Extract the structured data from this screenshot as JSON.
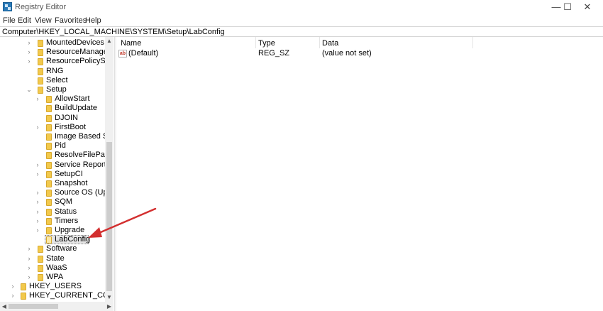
{
  "window": {
    "title": "Registry Editor",
    "controls": {
      "minimize": "—",
      "maximize": "☐",
      "close": "✕"
    }
  },
  "menu": [
    "File",
    "Edit",
    "View",
    "Favorites",
    "Help"
  ],
  "address": "Computer\\HKEY_LOCAL_MACHINE\\SYSTEM\\Setup\\LabConfig",
  "tree": [
    {
      "label": "MountedDevices",
      "depth": 3,
      "expander": "collapsed"
    },
    {
      "label": "ResourceManager",
      "depth": 3,
      "expander": "collapsed"
    },
    {
      "label": "ResourcePolicyStore",
      "depth": 3,
      "expander": "collapsed"
    },
    {
      "label": "RNG",
      "depth": 3,
      "expander": "none"
    },
    {
      "label": "Select",
      "depth": 3,
      "expander": "none"
    },
    {
      "label": "Setup",
      "depth": 3,
      "expander": "expanded"
    },
    {
      "label": "AllowStart",
      "depth": 4,
      "expander": "collapsed"
    },
    {
      "label": "BuildUpdate",
      "depth": 4,
      "expander": "none"
    },
    {
      "label": "DJOIN",
      "depth": 4,
      "expander": "none"
    },
    {
      "label": "FirstBoot",
      "depth": 4,
      "expander": "collapsed"
    },
    {
      "label": "Image Based Setu",
      "depth": 4,
      "expander": "none"
    },
    {
      "label": "Pid",
      "depth": 4,
      "expander": "none"
    },
    {
      "label": "ResolveFilePaths",
      "depth": 4,
      "expander": "none"
    },
    {
      "label": "Service Reporting",
      "depth": 4,
      "expander": "collapsed"
    },
    {
      "label": "SetupCI",
      "depth": 4,
      "expander": "collapsed"
    },
    {
      "label": "Snapshot",
      "depth": 4,
      "expander": "none"
    },
    {
      "label": "Source OS (Updat",
      "depth": 4,
      "expander": "collapsed"
    },
    {
      "label": "SQM",
      "depth": 4,
      "expander": "collapsed"
    },
    {
      "label": "Status",
      "depth": 4,
      "expander": "collapsed"
    },
    {
      "label": "Timers",
      "depth": 4,
      "expander": "collapsed"
    },
    {
      "label": "Upgrade",
      "depth": 4,
      "expander": "collapsed"
    },
    {
      "label": "LabConfig",
      "depth": 4,
      "expander": "none",
      "selected": true
    },
    {
      "label": "Software",
      "depth": 3,
      "expander": "collapsed"
    },
    {
      "label": "State",
      "depth": 3,
      "expander": "collapsed"
    },
    {
      "label": "WaaS",
      "depth": 3,
      "expander": "collapsed"
    },
    {
      "label": "WPA",
      "depth": 3,
      "expander": "collapsed"
    },
    {
      "label": "HKEY_USERS",
      "depth": 1,
      "expander": "collapsed"
    },
    {
      "label": "HKEY_CURRENT_CONFIG",
      "depth": 1,
      "expander": "collapsed"
    }
  ],
  "columns": {
    "name": "Name",
    "type": "Type",
    "data": "Data"
  },
  "values": [
    {
      "name": "(Default)",
      "type": "REG_SZ",
      "data": "(value not set)",
      "icon": "string-value-icon"
    }
  ],
  "colors": {
    "annotation_arrow": "#d32f2f",
    "folder": "#f2c94c",
    "selection": "#e5e5e5"
  }
}
